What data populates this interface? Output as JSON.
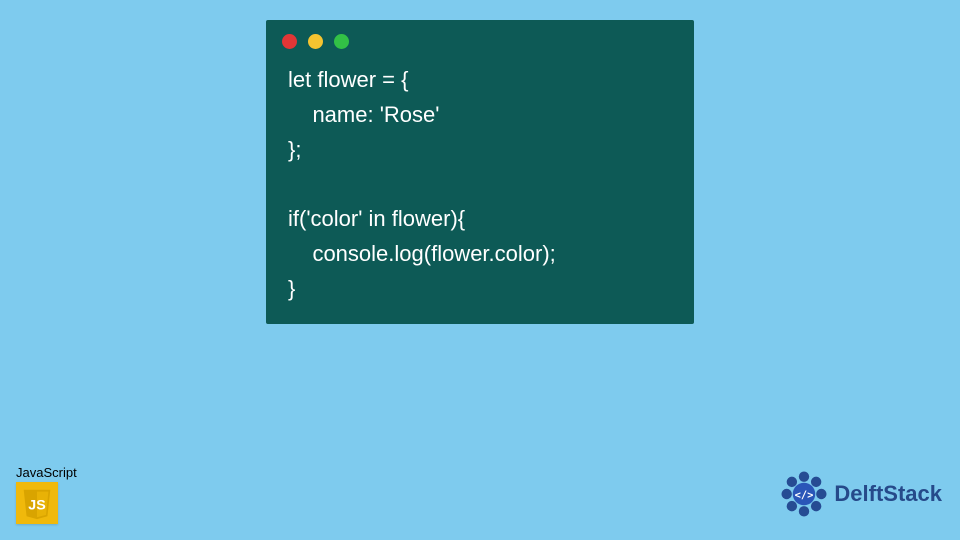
{
  "code_window": {
    "lines": [
      "let flower = {",
      "    name: 'Rose'",
      "};",
      "",
      "if('color' in flower){",
      "    console.log(flower.color);",
      "}"
    ]
  },
  "js_badge": {
    "label": "JavaScript",
    "icon_text": "JS"
  },
  "brand": {
    "name": "DelftStack"
  }
}
